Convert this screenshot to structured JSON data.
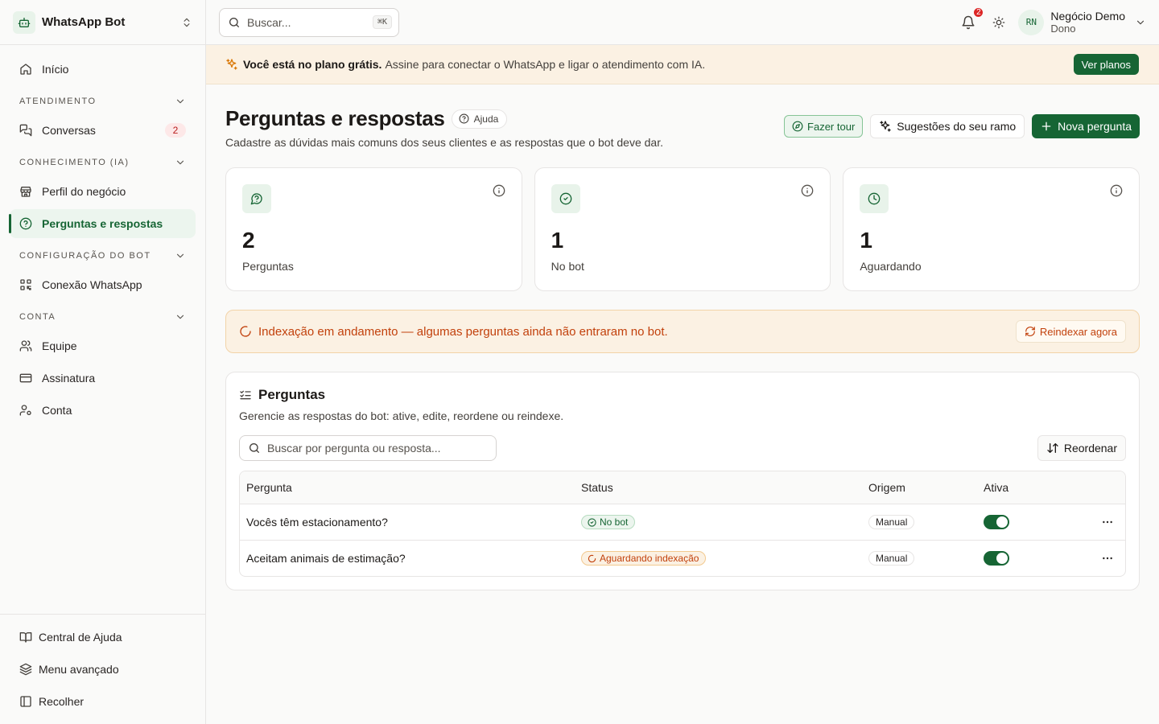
{
  "app": {
    "name": "WhatsApp Bot"
  },
  "sidebar": {
    "home": "Início",
    "sections": [
      {
        "title": "ATENDIMENTO"
      },
      {
        "title": "CONHECIMENTO (IA)"
      },
      {
        "title": "CONFIGURAÇÃO DO BOT"
      },
      {
        "title": "CONTA"
      }
    ],
    "items": {
      "conversas": {
        "label": "Conversas",
        "badge": "2"
      },
      "perfil": {
        "label": "Perfil do negócio"
      },
      "perguntas": {
        "label": "Perguntas e respostas"
      },
      "conexao": {
        "label": "Conexão WhatsApp"
      },
      "equipe": {
        "label": "Equipe"
      },
      "assinatura": {
        "label": "Assinatura"
      },
      "conta": {
        "label": "Conta"
      }
    },
    "bottom": {
      "help": "Central de Ajuda",
      "advanced": "Menu avançado",
      "collapse": "Recolher"
    }
  },
  "topbar": {
    "search_placeholder": "Buscar...",
    "shortcut": "⌘K",
    "notifications": "2",
    "user": {
      "initials": "RN",
      "name": "Negócio Demo",
      "role": "Dono"
    }
  },
  "banner": {
    "strong": "Você está no plano grátis.",
    "text": "Assine para conectar o WhatsApp e ligar o atendimento com IA.",
    "button": "Ver planos"
  },
  "page": {
    "title": "Perguntas e respostas",
    "help": "Ajuda",
    "subtitle": "Cadastre as dúvidas mais comuns dos seus clientes e as respostas que o bot deve dar.",
    "actions": {
      "tour": "Fazer tour",
      "suggestions": "Sugestões do seu ramo",
      "new": "Nova pergunta"
    }
  },
  "stats": [
    {
      "value": "2",
      "label": "Perguntas"
    },
    {
      "value": "1",
      "label": "No bot"
    },
    {
      "value": "1",
      "label": "Aguardando"
    }
  ],
  "alert": {
    "text": "Indexação em andamento — algumas perguntas ainda não entraram no bot.",
    "button": "Reindexar agora"
  },
  "panel": {
    "title": "Perguntas",
    "subtitle": "Gerencie as respostas do bot: ative, edite, reordene ou reindexe.",
    "search_placeholder": "Buscar por pergunta ou resposta...",
    "reorder": "Reordenar",
    "columns": {
      "question": "Pergunta",
      "status": "Status",
      "origin": "Origem",
      "active": "Ativa"
    },
    "rows": [
      {
        "question": "Vocês têm estacionamento?",
        "status": "No bot",
        "origin": "Manual",
        "active": true
      },
      {
        "question": "Aceitam animais de estimação?",
        "status": "Aguardando indexação",
        "origin": "Manual",
        "active": true
      }
    ]
  },
  "colors": {
    "brand": "#166534",
    "warning": "#c2410c",
    "danger": "#dc2626"
  }
}
